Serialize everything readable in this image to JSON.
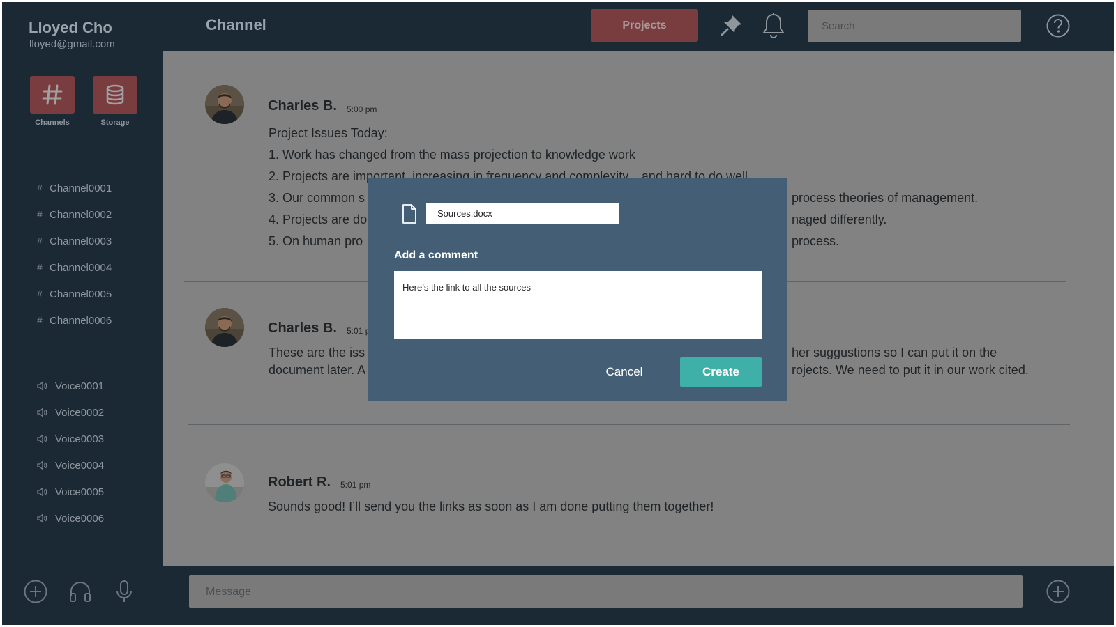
{
  "user": {
    "name": "Lloyed Cho",
    "email": "lloyed@gmail.com"
  },
  "tiles": [
    {
      "label": "Channels",
      "icon": "hash-icon"
    },
    {
      "label": "Storage",
      "icon": "database-icon"
    }
  ],
  "channels": [
    "Channel0001",
    "Channel0002",
    "Channel0003",
    "Channel0004",
    "Channel0005",
    "Channel0006"
  ],
  "voices": [
    "Voice0001",
    "Voice0002",
    "Voice0003",
    "Voice0004",
    "Voice0005",
    "Voice0006"
  ],
  "header": {
    "title": "Channel",
    "projects_label": "Projects",
    "search_placeholder": "Search"
  },
  "messages": [
    {
      "author": "Charles B.",
      "time": "5:00 pm",
      "lines": [
        "Project Issues Today:",
        "1. Work has changed from the mass projection to knowledge work",
        "2. Projects are important, increasing in frequency and complexity... and hard to do well",
        "3. Our common s",
        "process theories of management.",
        "4. Projects are do",
        "naged differently.",
        "5. On human pro",
        "process."
      ]
    },
    {
      "author": "Charles B.",
      "time": "5:01 p",
      "lines": [
        "These are the iss",
        "her suggustions so I can put it on the",
        "document later. A",
        "rojects. We need to put it in our work cited."
      ]
    },
    {
      "author": "Robert R.",
      "time": "5:01 pm",
      "lines": [
        "Sounds good! I’ll send you the links as soon as I am done putting them together!"
      ]
    }
  ],
  "message_bar": {
    "placeholder": "Message"
  },
  "modal": {
    "file_name": "Sources.docx",
    "comment_label": "Add a comment",
    "comment_text": "Here’s the link to all the sources",
    "cancel_label": "Cancel",
    "create_label": "Create"
  },
  "colors": {
    "sidebar_bg": "#1b2935",
    "main_bg_dimmed": "#828282",
    "modal_bg": "#445f75",
    "accent_red": "#7a3d3f",
    "create_button": "#3fb0a8"
  }
}
